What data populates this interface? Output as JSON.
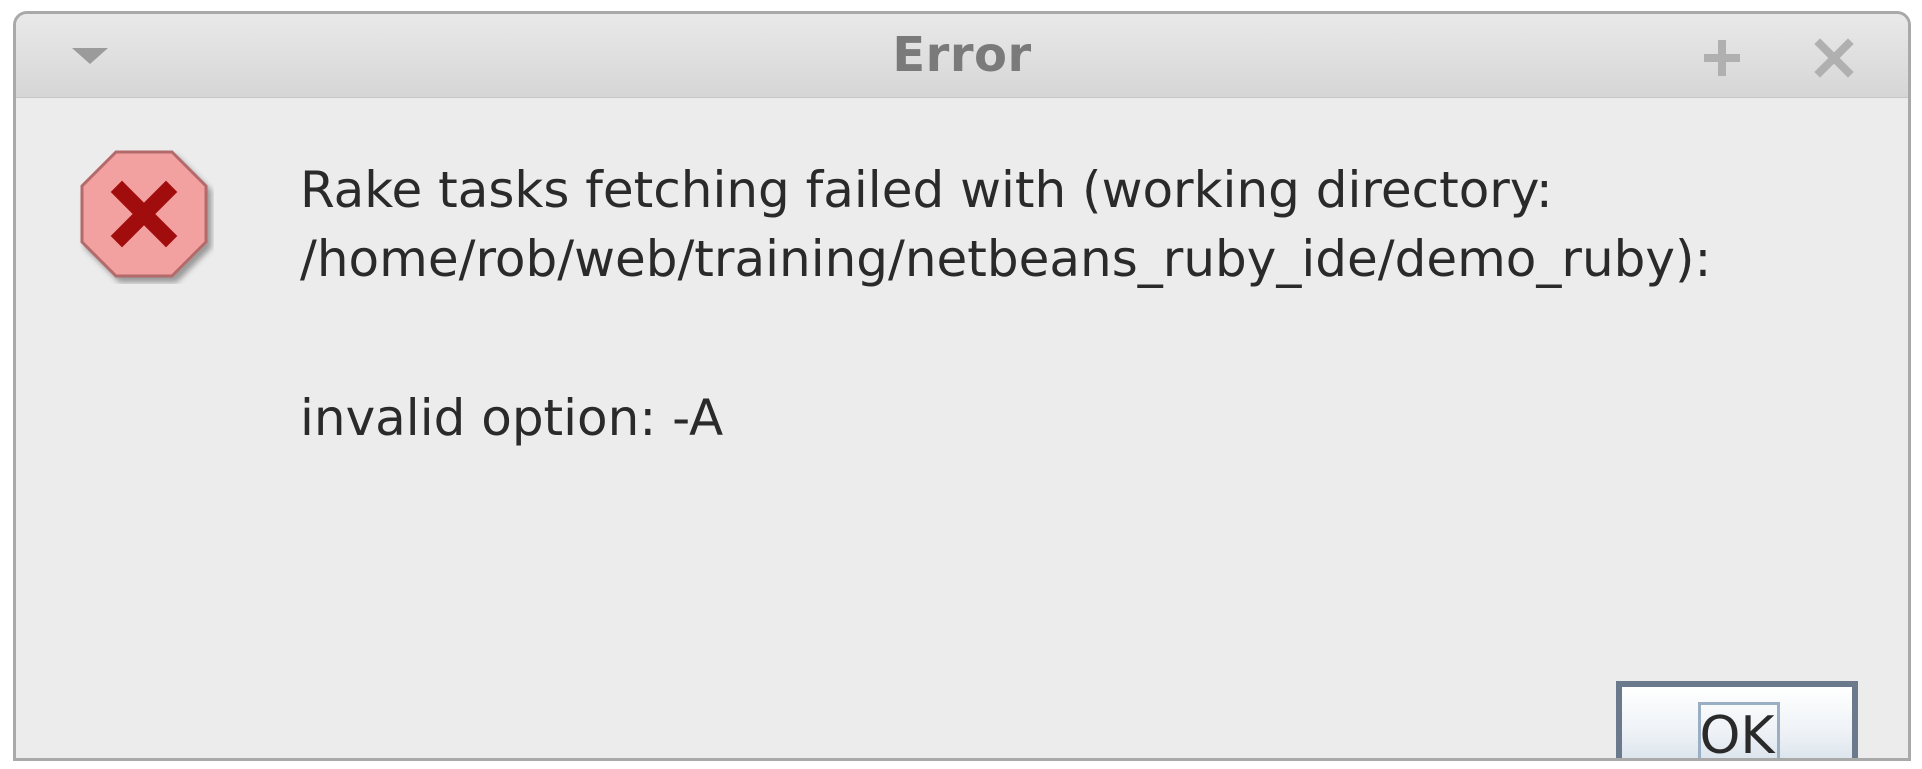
{
  "window": {
    "title": "Error"
  },
  "titlebar": {
    "menu_icon": "chevron-down-icon",
    "maximize_icon": "plus-icon",
    "close_icon": "close-icon"
  },
  "dialog": {
    "icon": "error-icon",
    "message_lines": [
      "Rake tasks fetching failed with (working directory:",
      "/home/rob/web/training/netbeans_ruby_ide/demo_ruby):",
      "invalid option: -A"
    ],
    "ok_label": "OK"
  },
  "colors": {
    "error_fill": "#f2a0a0",
    "error_mark": "#a10d0d",
    "background": "#ececec"
  }
}
